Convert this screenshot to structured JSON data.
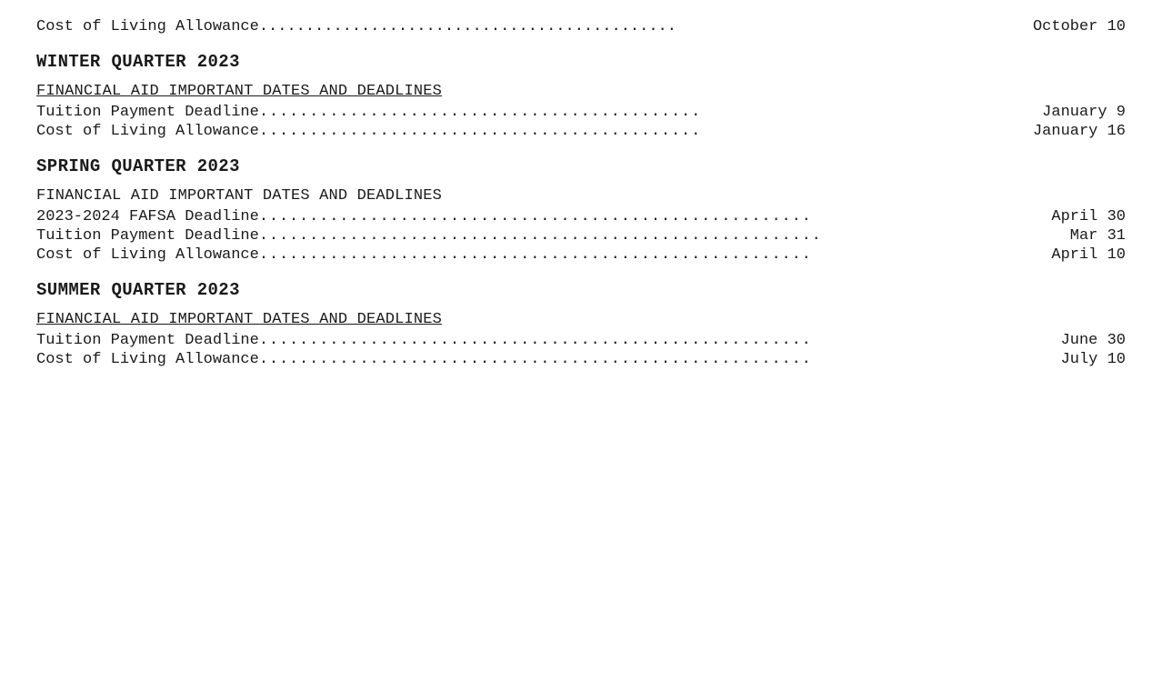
{
  "sections": [
    {
      "id": "top-item",
      "type": "top-deadline",
      "label": "Cost of Living Allowance ",
      "dots": ".............................................",
      "date": "October 10"
    },
    {
      "id": "winter-2023",
      "type": "quarter",
      "header": "WINTER QUARTER 2023",
      "subsections": [
        {
          "id": "winter-financial-aid",
          "title": "FINANCIAL AID IMPORTANT DATES AND DEADLINES",
          "deadlines": [
            {
              "id": "winter-tuition",
              "label": "Tuition Payment Deadline",
              "dots": "............................................",
              "date": "January 9",
              "style": "spaced"
            },
            {
              "id": "winter-cola",
              "label": "Cost of Living Allowance ",
              "dots": "............................................",
              "date": "January 16",
              "style": "spaced"
            }
          ]
        }
      ]
    },
    {
      "id": "spring-2023",
      "type": "quarter",
      "header": "SPRING QUARTER 2023",
      "subsections": [
        {
          "id": "spring-financial-aid",
          "title": "FINANCIAL AID IMPORTANT DATES AND DEADLINES",
          "title_underline": false,
          "deadlines": [
            {
              "id": "spring-fafsa",
              "label": "2023-2024 FAFSA Deadline",
              "dots": ".......................................................",
              "date": "April 30",
              "style": "right"
            },
            {
              "id": "spring-tuition",
              "label": "Tuition Payment Deadline",
              "dots": "........................................................",
              "date": "Mar 31",
              "style": "right"
            },
            {
              "id": "spring-cola",
              "label": "Cost of Living Allowance",
              "dots": ".......................................................",
              "date": "April 10",
              "style": "right"
            }
          ]
        }
      ]
    },
    {
      "id": "summer-2023",
      "type": "quarter",
      "header": "SUMMER QUARTER 2023",
      "subsections": [
        {
          "id": "summer-financial-aid",
          "title": "FINANCIAL AID IMPORTANT DATES AND DEADLINES",
          "title_underline": true,
          "deadlines": [
            {
              "id": "summer-tuition",
              "label": "Tuition Payment Deadline",
              "dots": ".......................................................",
              "date": "June 30",
              "style": "right"
            },
            {
              "id": "summer-cola",
              "label": "Cost of Living Allowance",
              "dots": ".......................................................",
              "date": "July 10",
              "style": "right"
            }
          ]
        }
      ]
    }
  ]
}
